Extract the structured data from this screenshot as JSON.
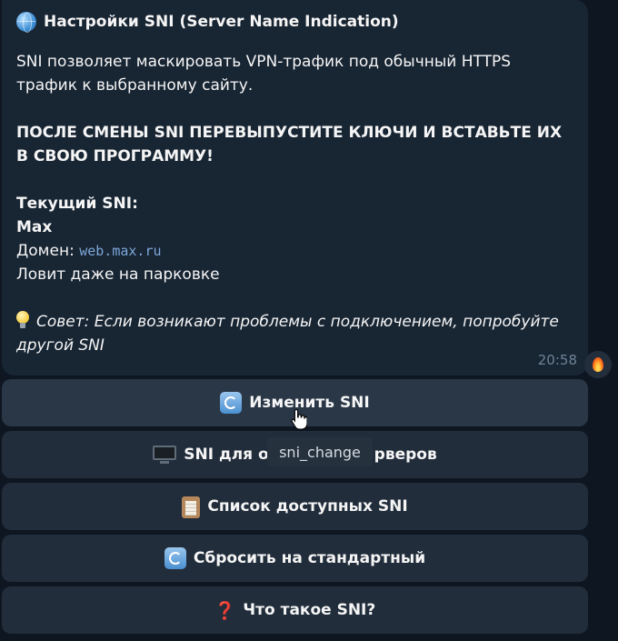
{
  "message": {
    "title": "Настройки SNI (Server Name Indication)",
    "description": "SNI позволяет маскировать VPN-трафик под обычный HTTPS трафик к выбранному сайту.",
    "warning": "ПОСЛЕ СМЕНЫ SNI ПЕРЕВЫПУСТИТЕ КЛЮЧИ И ВСТАВЬТЕ ИХ В СВОЮ ПРОГРАММУ!",
    "current_label": "Текущий SNI:",
    "current_value": "Max",
    "domain_label": "Домен:",
    "domain_value": "web.max.ru",
    "note": "Ловит даже на парковке",
    "tip": "Совет: Если возникают проблемы с подключением, попробуйте другой SNI",
    "time": "20:58"
  },
  "buttons": {
    "change": "Изменить SNI",
    "servers_prefix": "SNI для о",
    "servers_suffix": "рверов",
    "list": "Список доступных SNI",
    "reset": "Сбросить на стандартный",
    "what": "Что такое SNI?"
  },
  "tooltip": "sni_change",
  "icons": {
    "title": "globe-icon",
    "tip": "light-bulb-icon",
    "reaction": "fire-icon",
    "change": "refresh-icon",
    "servers": "monitor-icon",
    "list": "clipboard-icon",
    "reset": "refresh-icon",
    "what": "question-icon"
  },
  "colors": {
    "background": "#0e1621",
    "bubble": "#182533",
    "button": "#212d3b",
    "link": "#7ca7d8",
    "time": "#6d8396"
  }
}
